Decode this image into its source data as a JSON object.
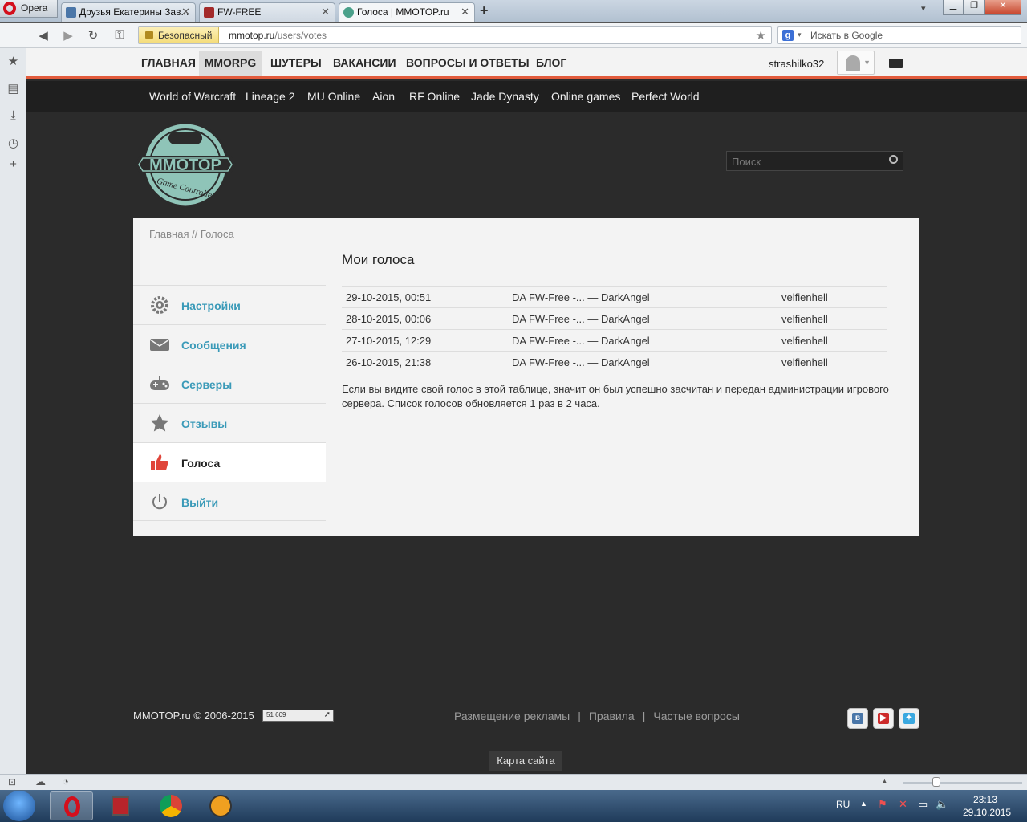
{
  "browser": {
    "opera_label": "Opera",
    "tabs": [
      {
        "label": "Друзья Екатерины Зав..."
      },
      {
        "label": "FW-FREE"
      },
      {
        "label": "Голоса | MMOTOP.ru"
      }
    ],
    "new_tab": "+",
    "secure_label": "Безопасный",
    "url_host": "mmotop.ru",
    "url_path": "/users/votes",
    "search_placeholder": "Искать в Google",
    "google_letter": "g"
  },
  "site": {
    "top_nav": [
      "ГЛАВНАЯ",
      "MMORPG",
      "ШУТЕРЫ",
      "ВАКАНСИИ",
      "ВОПРОСЫ И ОТВЕТЫ",
      "БЛОГ"
    ],
    "username": "strashilko32",
    "games": [
      "World of Warcraft",
      "Lineage 2",
      "MU Online",
      "Aion",
      "RF Online",
      "Jade Dynasty",
      "Online games",
      "Perfect World"
    ],
    "search_placeholder": "Поиск",
    "logo": {
      "title": "MMOTOP",
      "subtitle": "Game Controller"
    },
    "breadcrumb": "Главная // Голоса",
    "heading": "Мои голоса",
    "menu": [
      {
        "label": "Настройки",
        "icon": "gear-icon"
      },
      {
        "label": "Сообщения",
        "icon": "envelope-icon"
      },
      {
        "label": "Серверы",
        "icon": "gamepad-icon"
      },
      {
        "label": "Отзывы",
        "icon": "star-icon"
      },
      {
        "label": "Голоса",
        "icon": "thumbs-up-icon"
      },
      {
        "label": "Выйти",
        "icon": "power-icon"
      }
    ],
    "votes": [
      {
        "date": "29-10-2015, 00:51",
        "server": "DA FW-Free -... — DarkAngel",
        "user": "velfienhell"
      },
      {
        "date": "28-10-2015, 00:06",
        "server": "DA FW-Free -... — DarkAngel",
        "user": "velfienhell"
      },
      {
        "date": "27-10-2015, 12:29",
        "server": "DA FW-Free -... — DarkAngel",
        "user": "velfienhell"
      },
      {
        "date": "26-10-2015, 21:38",
        "server": "DA FW-Free -... — DarkAngel",
        "user": "velfienhell"
      }
    ],
    "note": "Если вы видите свой голос в этой таблице, значит он был успешно засчитан и передан администрации игрового сервера. Список голосов обновляется 1 раз в 2 часа.",
    "footer": {
      "copyright": "MMOTOP.ru © 2006-2015",
      "counter": "51 609",
      "links": [
        "Размещение рекламы",
        "Правила",
        "Частые вопросы"
      ],
      "separator": "|",
      "vk_letter": "в",
      "sitemap": "Карта сайта"
    }
  },
  "taskbar": {
    "lang": "RU",
    "time": "23:13",
    "date": "29.10.2015"
  },
  "colors": {
    "accent": "#e25b3c",
    "link": "#3a9ab8"
  }
}
